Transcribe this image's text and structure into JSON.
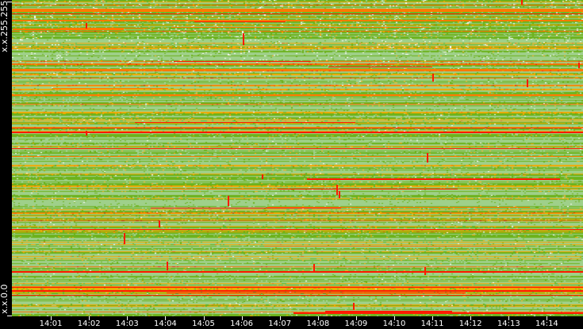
{
  "chart_data": {
    "type": "heatmap",
    "title": "",
    "xlabel": "",
    "ylabel": "",
    "x_ticks": [
      "14:01",
      "14:02",
      "14:03",
      "14:04",
      "14:05",
      "14:06",
      "14:07",
      "14:08",
      "14:09",
      "14:10",
      "14:11",
      "14:12",
      "14:13",
      "14:14"
    ],
    "x_range": [
      "14:00",
      "14:15"
    ],
    "y_labels": {
      "top": "x.x.255.255",
      "bottom": "x.x.0.0"
    },
    "color_scale": [
      "#ffffff",
      "#9fd08a",
      "#6cb21a",
      "#f5a800",
      "#ff6a00",
      "#ff1a00"
    ],
    "grid": false,
    "legend": "none"
  }
}
